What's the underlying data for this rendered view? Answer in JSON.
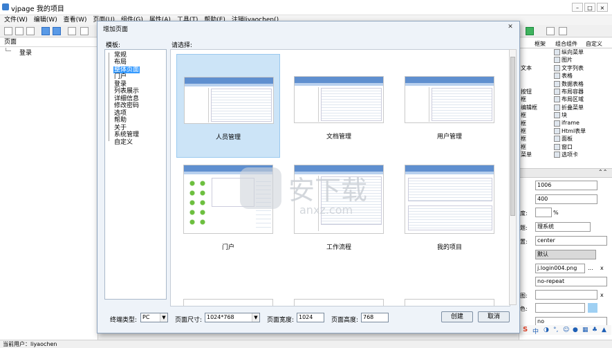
{
  "app": {
    "title": "vjpage 我的项目",
    "menus": [
      "文件(W)",
      "编辑(W)",
      "查看(W)",
      "页面(U)",
      "组件(G)",
      "属性(A)",
      "工具(T)",
      "帮助(E)",
      "注销liyaochen()"
    ]
  },
  "left_panel": {
    "header": "页面",
    "items": [
      "登录"
    ]
  },
  "right_panel": {
    "tabs": [
      "框架",
      "组合组件",
      "自定义"
    ],
    "components": [
      "纵向菜单",
      "图片",
      "文字列表",
      "表格",
      "数据表格",
      "布局容器",
      "布局区域",
      "折叠菜单",
      "块",
      "iframe",
      "Html表单",
      "面板",
      "窗口",
      "选项卡"
    ],
    "partial_left": [
      "文本",
      "按钮",
      "框",
      "编辑框",
      "框",
      "框",
      "框",
      "框",
      "框",
      "菜单"
    ],
    "props": [
      "1006",
      "400",
      "%",
      "理系统",
      "center",
      "默认",
      "j.login004.png",
      "no-repeat",
      "",
      "",
      "no"
    ],
    "prop_labels_partial": [
      "度:",
      "题:",
      "置:",
      "色:",
      "图:"
    ]
  },
  "status_bar": {
    "text": "当前用户：liyaochen"
  },
  "dialog": {
    "title": "增加页面",
    "template_label": "模板:",
    "choose_label": "请选择:",
    "templates": [
      "常规",
      "布局",
      "整体页面",
      "门户",
      "登录",
      "列表展示",
      "详细信息",
      "修改密码",
      "选项",
      "帮助",
      "关于",
      "系统管理",
      "自定义"
    ],
    "selected_template": "整体页面",
    "cards": [
      {
        "label": "人员管理",
        "selected": true
      },
      {
        "label": "文档管理",
        "selected": false
      },
      {
        "label": "用户管理",
        "selected": false
      },
      {
        "label": "门户",
        "selected": false
      },
      {
        "label": "工作流程",
        "selected": false
      },
      {
        "label": "我的项目",
        "selected": false
      }
    ],
    "footer": {
      "terminal_label": "终端类型:",
      "terminal_value": "PC",
      "size_label": "页面尺寸:",
      "size_value": "1024*768",
      "width_label": "页面宽度:",
      "width_value": "1024",
      "height_label": "页面高度:",
      "height_value": "768",
      "create_button": "创建",
      "cancel_button": "取消"
    }
  },
  "watermark": {
    "text": "安下载",
    "sub": "anxz.com"
  }
}
